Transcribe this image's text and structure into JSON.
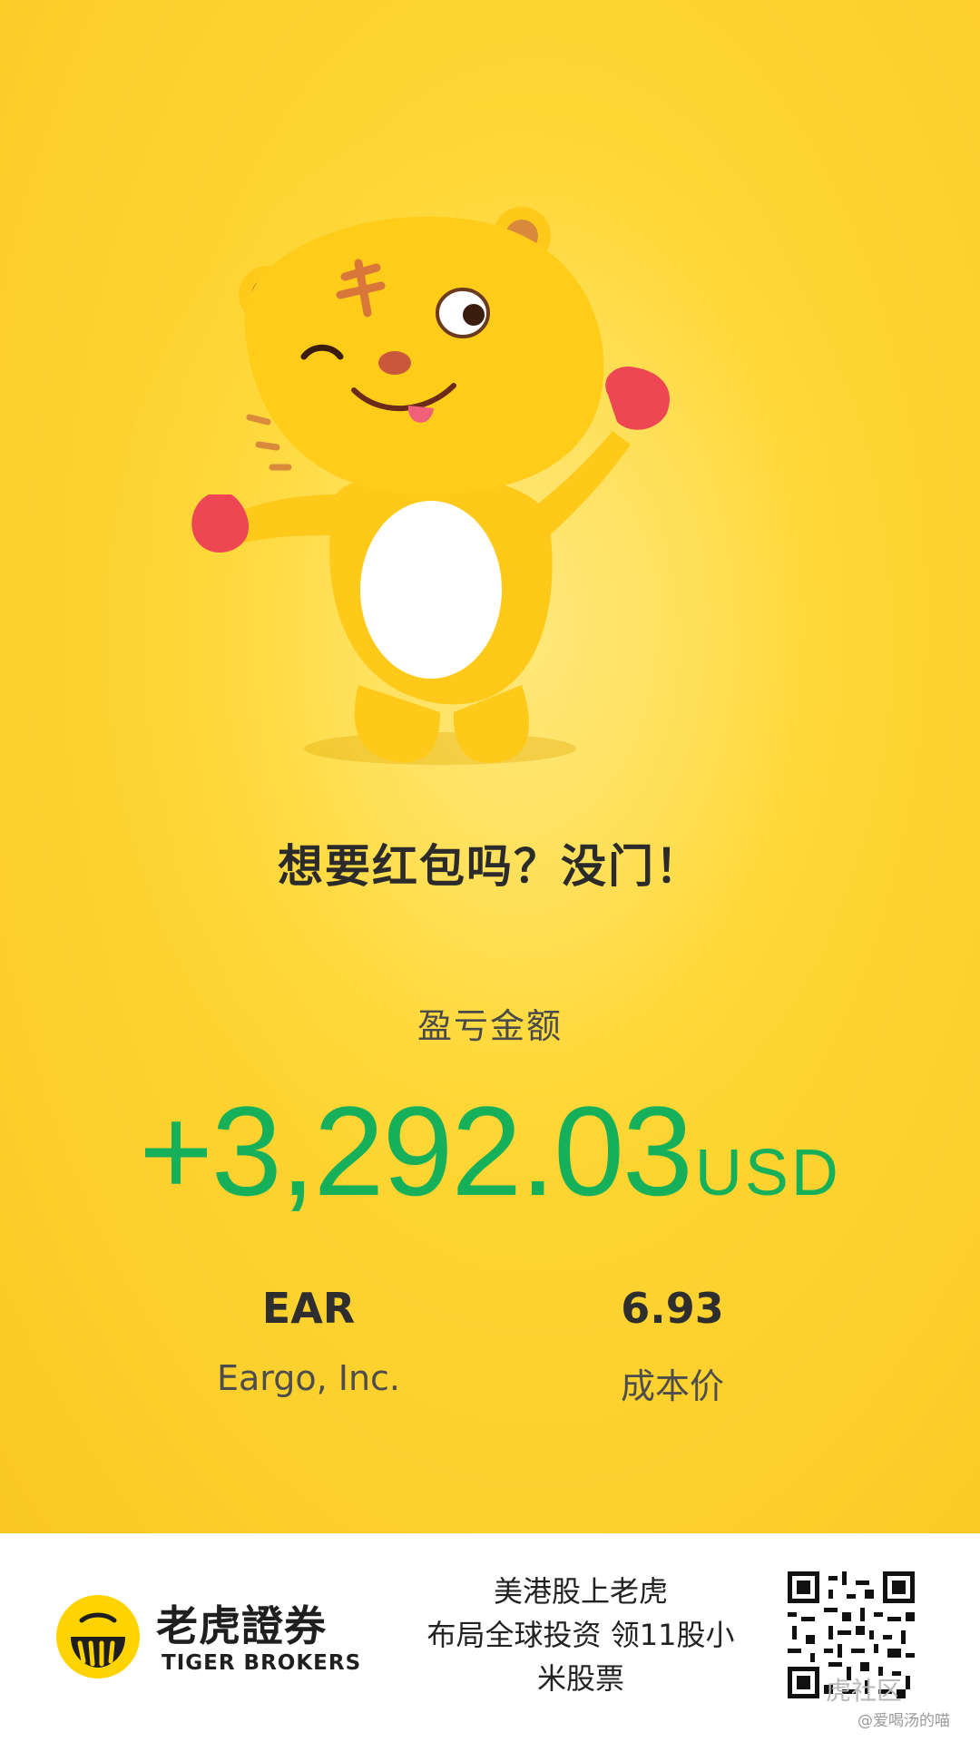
{
  "poster": {
    "headline": "想要红包吗？没门！",
    "pnl_label": "盈亏金额",
    "pnl_amount": "+3,292.03",
    "pnl_currency": "USD",
    "ticker": "EAR",
    "company": "Eargo, Inc.",
    "cost_price": "6.93",
    "cost_label": "成本价",
    "colors": {
      "profit": "#16b05a",
      "background": "#fcd02d"
    },
    "mascot": "tiger-mascot-icon"
  },
  "footer": {
    "brand_cn": "老虎證券",
    "brand_en": "TIGER BROKERS",
    "promo_lines": [
      "美港股上老虎",
      "布局全球投资 领11股小",
      "米股票"
    ],
    "watermark_community": "虎社区",
    "watermark_user": "@爱喝汤的喵",
    "icons": [
      "tiger-logo-icon",
      "qr-code-icon"
    ]
  }
}
